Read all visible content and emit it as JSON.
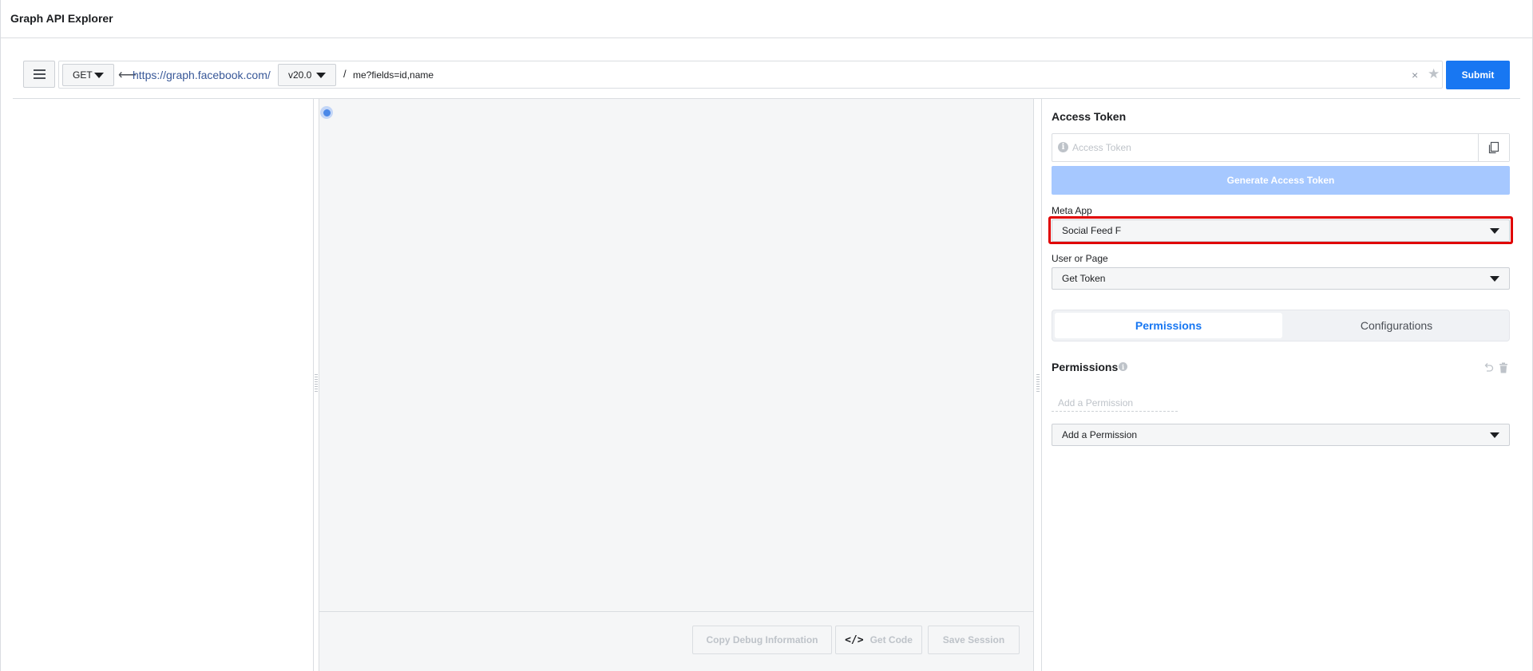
{
  "app": {
    "title": "Graph API Explorer"
  },
  "query": {
    "method": "GET",
    "base_url": "https://graph.facebook.com/",
    "version": "v20.0",
    "separator": "/",
    "path": "me?fields=id,name",
    "submit_label": "Submit",
    "clear_glyph": "×",
    "favorite_glyph": "★",
    "back_arrow_glyph": "⟵"
  },
  "center": {
    "buttons": {
      "copy_debug": "Copy Debug Information",
      "get_code": "Get Code",
      "get_code_glyph": "</>",
      "save_session": "Save Session"
    }
  },
  "right": {
    "access_token_title": "Access Token",
    "access_token_placeholder": "Access Token",
    "info_glyph": "i",
    "generate_label": "Generate Access Token",
    "meta_app_label": "Meta App",
    "meta_app_value": "Social Feed F",
    "user_or_page_label": "User or Page",
    "user_or_page_value": "Get Token",
    "tabs": [
      {
        "label": "Permissions",
        "active": true
      },
      {
        "label": "Configurations",
        "active": false
      }
    ],
    "permissions_title": "Permissions",
    "add_permission_placeholder": "Add a Permission",
    "add_permission_select": "Add a Permission"
  },
  "colors": {
    "primary": "#1877f2",
    "disabled_primary": "#a6c8ff",
    "highlight": "#e00000"
  }
}
